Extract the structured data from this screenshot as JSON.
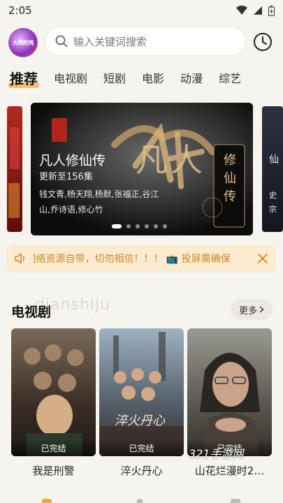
{
  "status_bar": {
    "time": "2:05"
  },
  "logo": {
    "text": "大鸡吃鸡"
  },
  "search": {
    "placeholder": "输入关键词搜索"
  },
  "tabs": [
    {
      "label": "推荐",
      "active": true
    },
    {
      "label": "电视剧",
      "active": false
    },
    {
      "label": "短剧",
      "active": false
    },
    {
      "label": "电影",
      "active": false
    },
    {
      "label": "动漫",
      "active": false
    },
    {
      "label": "综艺",
      "active": false
    }
  ],
  "banner": {
    "title": "凡人修仙传",
    "update": "更新至156集",
    "cast": "钱文青,杨天翔,杨默,张福正,谷江山,乔诗语,修心竹",
    "poster_title": "凡人",
    "poster_subtitle": "修仙传",
    "slide_count": 6,
    "active_slide": 1,
    "right_peek_text": "仙",
    "right_peek_sub": "史宗"
  },
  "notice": {
    "text": "]络资源自带，切勿相信！！！ 📺 投屏需确保"
  },
  "section": {
    "title": "电视剧",
    "more_label": "更多",
    "faint_text": "dianshiju"
  },
  "cards": [
    {
      "title": "我是刑警",
      "badge": "已完结",
      "color_top": "#6a5a4a",
      "color_bottom": "#2e2520"
    },
    {
      "title": "淬火丹心",
      "badge": "已完结",
      "color_top": "#8a9cb0",
      "color_bottom": "#3a3a40",
      "overlay": "淬火丹心"
    },
    {
      "title": "山花烂漫时2…",
      "badge": "已完结",
      "color_top": "#8a8a80",
      "color_bottom": "#3e3a34"
    }
  ],
  "watermark": "321手游网",
  "colors": {
    "accent": "#f3c06b",
    "notice_bg": "#fbecd1",
    "notice_text": "#c88a24",
    "background": "#f6f4ef"
  }
}
